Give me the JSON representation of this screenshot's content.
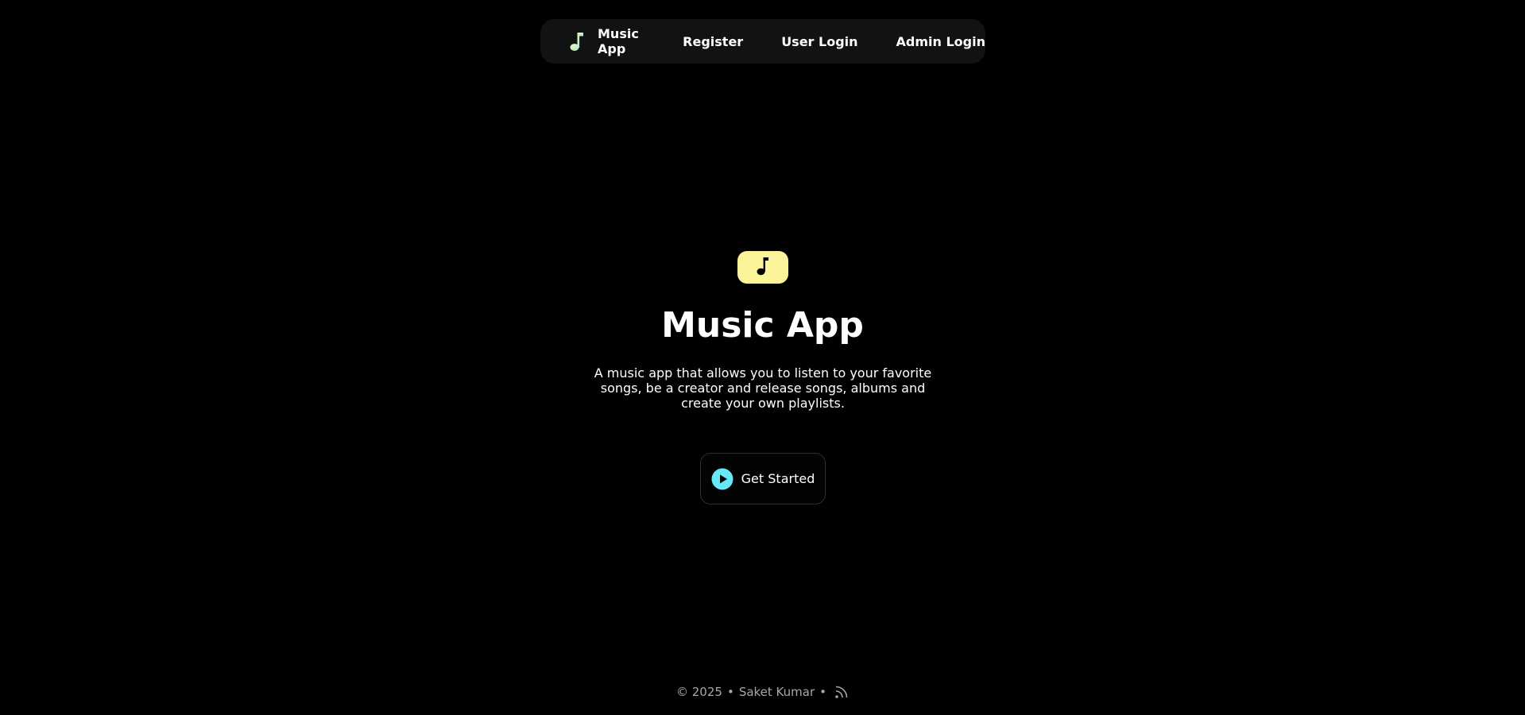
{
  "navbar": {
    "brand_label": "Music App",
    "brand_icon": "music-note-icon",
    "links": {
      "register": "Register",
      "user_login": "User Login",
      "admin_login": "Admin Login"
    }
  },
  "hero": {
    "icon": "music-note-icon",
    "title": "Music App",
    "description": "A music app that allows you to listen to your favorite songs, be a creator and release songs, albums and create your own playlists.",
    "cta_label": "Get Started",
    "cta_icon": "play-circle-icon"
  },
  "footer": {
    "copyright": "© 2025",
    "separator": "•",
    "author": "Saket Kumar",
    "feed_icon": "rss-icon"
  },
  "colors": {
    "background": "#000000",
    "navbar_bg": "#111214",
    "accent_yellow": "#fbf49a",
    "play_cyan": "#67e8f9",
    "footer_text": "#a8a8a8"
  }
}
